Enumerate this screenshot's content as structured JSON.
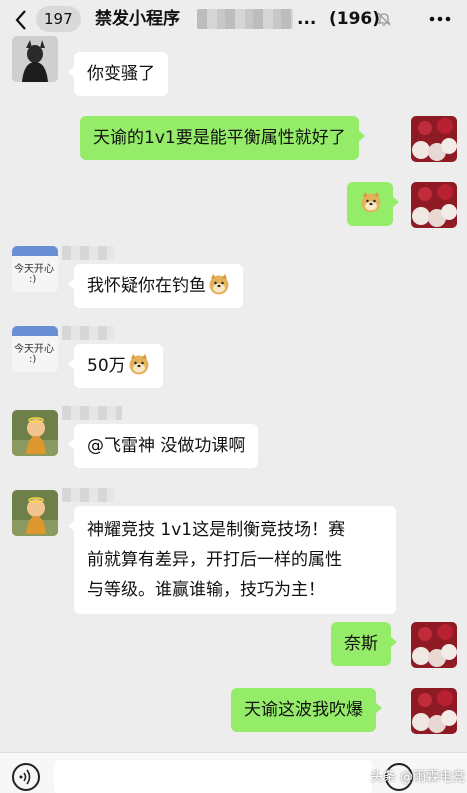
{
  "header": {
    "unread_count": "197",
    "title": "禁发小程序",
    "title_ellipsis": "...",
    "member_count": "(196)"
  },
  "messages": [
    {
      "side": "left",
      "text": "你变骚了",
      "avatar": "black-figure"
    },
    {
      "side": "right",
      "text": "天谕的1v1要是能平衡属性就好了"
    },
    {
      "side": "right",
      "text": "",
      "emoji": "doge-emoji"
    },
    {
      "side": "left",
      "text": "我怀疑你在钓鱼",
      "emoji": "doge-emoji",
      "avatar": "today-happy"
    },
    {
      "side": "left",
      "text": "50万",
      "emoji": "doge-emoji",
      "avatar": "today-happy"
    },
    {
      "side": "left",
      "text": "@飞雷神 没做功课啊",
      "avatar": "doll"
    },
    {
      "side": "left",
      "lines": [
        "神耀竞技 1v1这是制衡竞技场！赛",
        "前就算有差异，开打后一样的属性",
        "与等级。谁赢谁输，技巧为主！"
      ],
      "avatar": "doll"
    },
    {
      "side": "right",
      "text": "奈斯"
    },
    {
      "side": "right",
      "text": "天谕这波我吹爆"
    }
  ],
  "avatar_text": {
    "today_happy_line1": "今天开心",
    "today_happy_line2": ":)"
  },
  "watermark": "头条 @雨霖电竞",
  "colors": {
    "bg": "#ededed",
    "bubble_right": "#95ec69",
    "bubble_left": "#ffffff"
  }
}
